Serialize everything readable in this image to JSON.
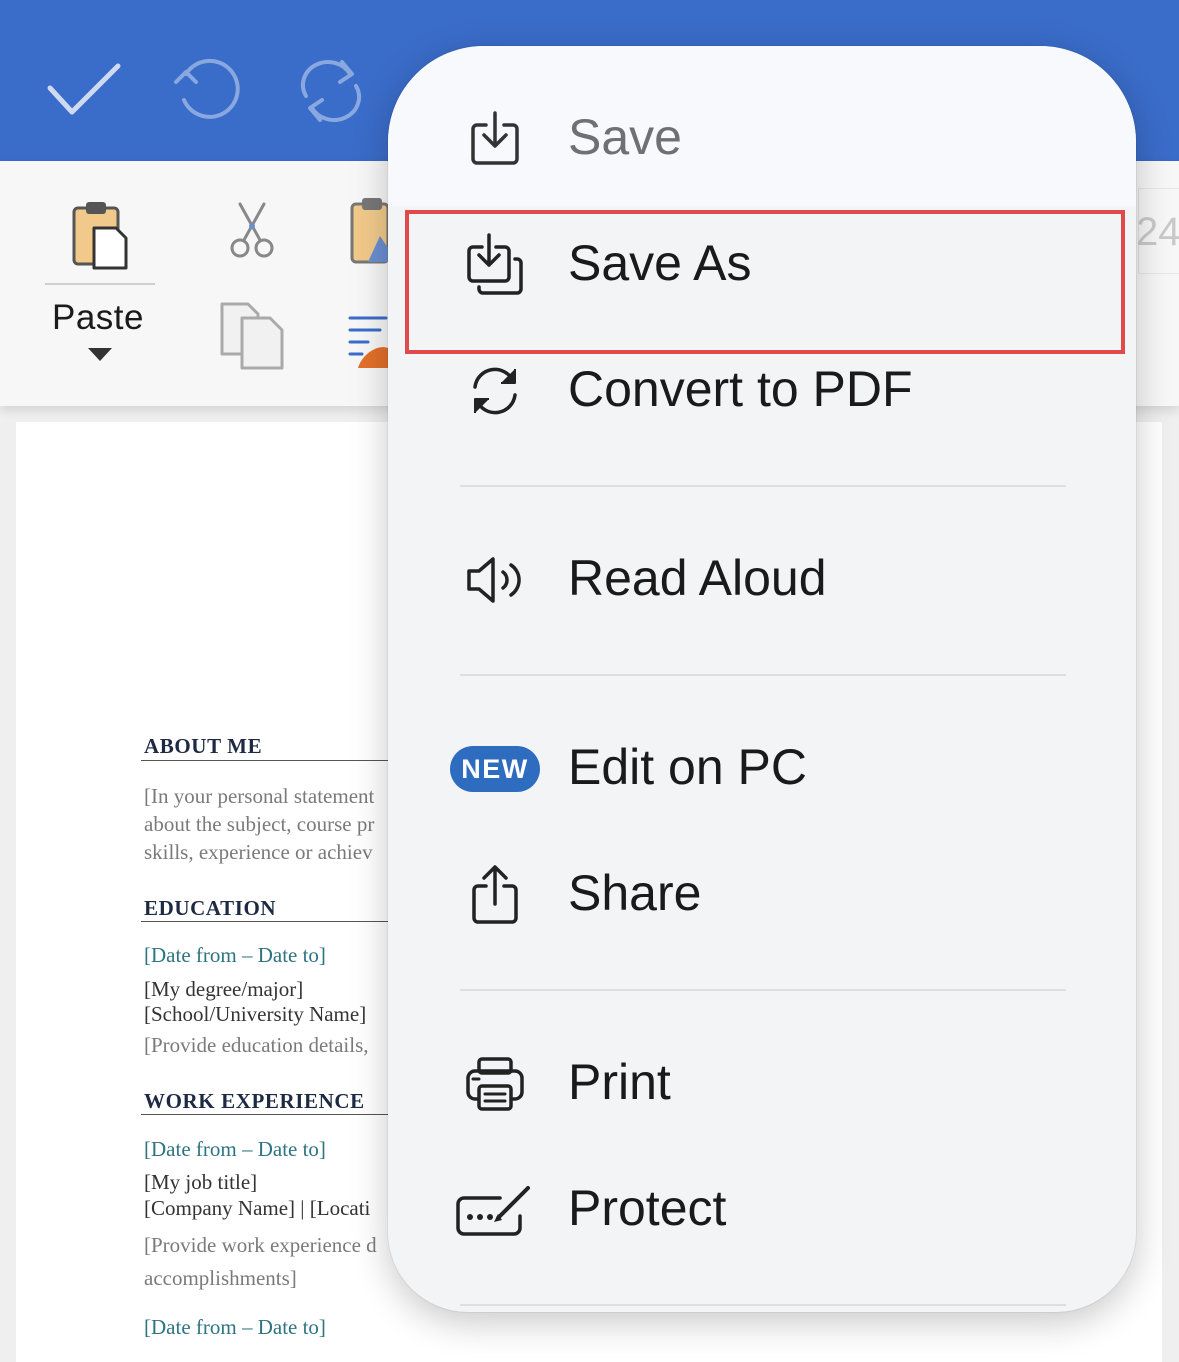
{
  "ribbon": {
    "paste_label": "Paste",
    "partial_number": "24"
  },
  "document": {
    "about_heading": "ABOUT ME",
    "about_lines": [
      "[In your personal statement",
      "about the subject, course pr",
      "skills, experience or achiev"
    ],
    "education_heading": "EDUCATION",
    "edu_date": "[Date from – Date to]",
    "edu_degree": "[My degree/major]",
    "edu_school": "[School/University Name]",
    "edu_details": "[Provide education details,",
    "work_heading": "WORK EXPERIENCE",
    "work_date": "[Date from – Date to]",
    "work_title": "[My job title]",
    "work_company": "[Company Name] | [Locati",
    "work_details": "[Provide work experience d",
    "work_accomplishments": "accomplishments]",
    "work_date2": "[Date from – Date to]"
  },
  "menu": {
    "items": [
      {
        "label": "Save",
        "icon": "save-icon",
        "disabled": true
      },
      {
        "label": "Save As",
        "icon": "save-as-icon",
        "highlighted": true
      },
      {
        "label": "Convert to PDF",
        "icon": "convert-icon"
      },
      {
        "label": "Read Aloud",
        "icon": "speaker-icon"
      },
      {
        "label": "Edit on PC",
        "icon": "new-badge",
        "badge": "NEW"
      },
      {
        "label": "Share",
        "icon": "share-icon"
      },
      {
        "label": "Print",
        "icon": "printer-icon"
      },
      {
        "label": "Protect",
        "icon": "protect-icon"
      }
    ]
  },
  "colors": {
    "topbar": "#3a6cc9",
    "highlight": "#e04a4a",
    "badge": "#2e6cc0",
    "doc_teal": "#2e7481"
  }
}
